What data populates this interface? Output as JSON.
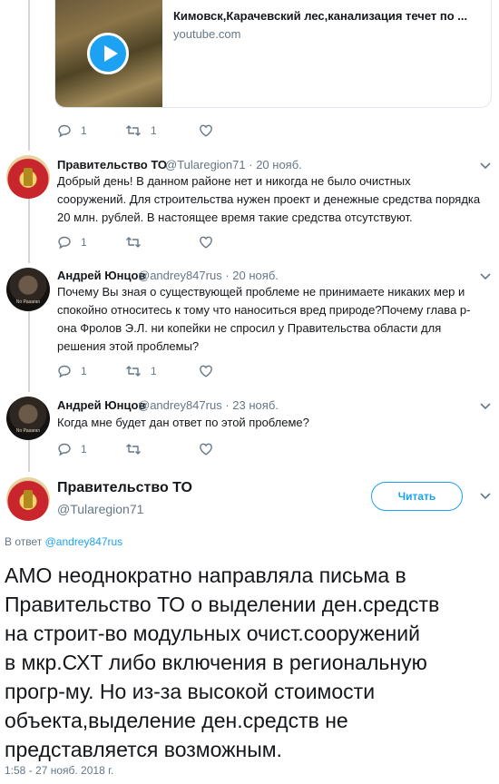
{
  "link_card": {
    "title": "Кимовск,Карачевский лес,канализация течет по ...",
    "domain": "youtube.com"
  },
  "tweets": [
    {
      "actions": {
        "replies": "1",
        "retweets": "1",
        "likes": ""
      }
    },
    {
      "name": "Правительство ТО",
      "handle": "@Tularegion71",
      "date": "20 нояб.",
      "lines": [
        "Добрый день! В данном районе нет и никогда не было очистных",
        "сооружений. Для  строительства нужен проект и денежные средства порядка",
        "20 млн. рублей. В  настоящее время такие средства отсутствуют."
      ],
      "actions": {
        "replies": "1",
        "retweets": "",
        "likes": ""
      }
    },
    {
      "name": "Андрей Юнцов",
      "handle": "@andrey847rus",
      "date": "20 нояб.",
      "lines": [
        "Почему Вы зная о существующей проблеме не принимаете никаких мер и",
        "спокойно относитесь к тому что наноситься вред природе?Почему глава р-",
        "она Фролов Э.Л. ни копейки не спросил у Правительства области для",
        "решения этой проблемы?"
      ],
      "actions": {
        "replies": "1",
        "retweets": "1",
        "likes": ""
      }
    },
    {
      "name": "Андрей Юнцов",
      "handle": "@andrey847rus",
      "date": "23 нояб.",
      "lines": [
        "Когда мне будет дан ответ по этой проблеме?"
      ],
      "actions": {
        "replies": "1",
        "retweets": "",
        "likes": ""
      }
    }
  ],
  "avatar_caption": "No Pasaran",
  "separator": "·",
  "main_tweet": {
    "name": "Правительство ТО",
    "handle": "@Tularegion71",
    "follow_label": "Читать",
    "reply_prefix": "В ответ",
    "reply_handle": "@andrey847rus",
    "lines": [
      "АМО неоднократно направляла письма в",
      "Правительство ТО о выделении ден.средств",
      "на строит-во модульных очист.сооружений",
      "в мкр.СХТ либо включения в региональную",
      "прогр-му. Но из-за высокой стоимости",
      "объекта,выделение ден.средств не",
      "представляется возможным."
    ],
    "timestamp": "1:58 - 27 нояб. 2018 г."
  },
  "colors": {
    "accent": "#1da1f2",
    "secondary_text": "#657786",
    "border": "#e1e8ed",
    "thread_line": "#ccd6dd"
  }
}
